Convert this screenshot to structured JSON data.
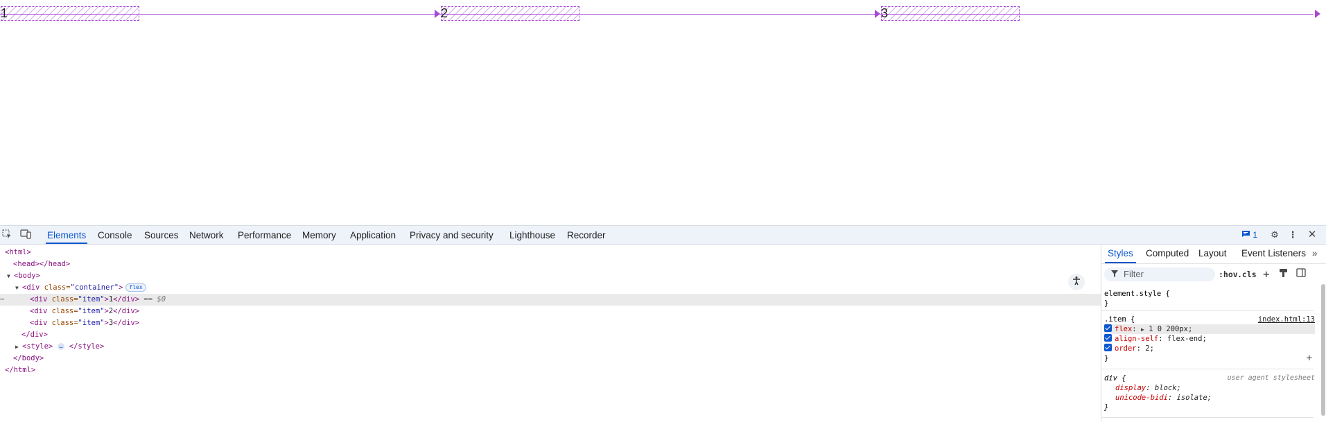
{
  "viewport": {
    "items": [
      {
        "label": "1"
      },
      {
        "label": "2"
      },
      {
        "label": "3"
      }
    ],
    "overlay_color": "#a64ad6"
  },
  "devtools": {
    "tabs": [
      "Elements",
      "Console",
      "Sources",
      "Network",
      "Performance",
      "Memory",
      "Application",
      "Privacy and security",
      "Lighthouse",
      "Recorder"
    ],
    "active_tab": "Elements",
    "issues_count": "1",
    "dom": {
      "html_open": "<html>",
      "head": "<head></head>",
      "body_open": "<body>",
      "div_container_tag": "<div ",
      "div_container_attr": "class=",
      "div_container_val": "\"container\"",
      "div_container_close": ">",
      "flex_badge": "flex",
      "items": [
        {
          "open": "<div ",
          "attr": "class=",
          "val": "\"item\"",
          "gt": ">",
          "text": "1",
          "close": "</div>",
          "selected_marker": "== $0"
        },
        {
          "open": "<div ",
          "attr": "class=",
          "val": "\"item\"",
          "gt": ">",
          "text": "2",
          "close": "</div>"
        },
        {
          "open": "<div ",
          "attr": "class=",
          "val": "\"item\"",
          "gt": ">",
          "text": "3",
          "close": "</div>"
        }
      ],
      "div_close": "</div>",
      "style_open": "<style>",
      "style_ellipsis": "…",
      "style_close": "</style>",
      "body_close": "</body>",
      "html_close": "</html>"
    },
    "styles": {
      "tabs": [
        "Styles",
        "Computed",
        "Layout",
        "Event Listeners"
      ],
      "active_tab": "Styles",
      "filter_placeholder": "Filter",
      "hov": ":hov",
      "cls": ".cls",
      "element_style_selector": "element.style {",
      "element_style_close": "}",
      "item_rule": {
        "selector": ".item {",
        "source": "index.html:13",
        "props": [
          {
            "name": "flex",
            "value": "1 0 200px;",
            "has_triangle": true
          },
          {
            "name": "align-self",
            "value": "flex-end;"
          },
          {
            "name": "order",
            "value": "2;"
          }
        ],
        "close": "}"
      },
      "ua_rule": {
        "selector": "div {",
        "source": "user agent stylesheet",
        "props": [
          {
            "name": "display",
            "value": "block;"
          },
          {
            "name": "unicode-bidi",
            "value": "isolate;"
          }
        ],
        "close": "}"
      }
    }
  }
}
